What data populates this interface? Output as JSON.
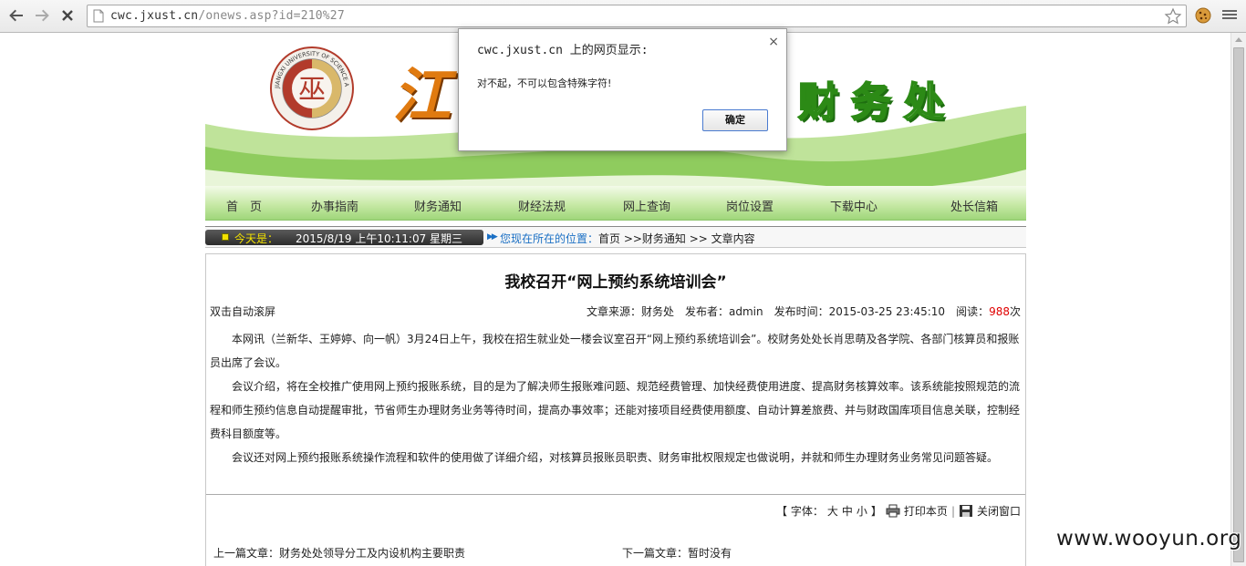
{
  "browser": {
    "url_host": "cwc.jxust.cn",
    "url_rest": "/onews.asp?id=210%27"
  },
  "banner": {
    "title_char": "江",
    "department": "财务处",
    "seal_text": "JIANGXI UNIVERSITY OF SCIENCE AND TECHNOLOGY"
  },
  "nav": {
    "items": [
      "首　页",
      "办事指南",
      "财务通知",
      "财经法规",
      "网上查询",
      "岗位设置",
      "下载中心",
      "处长信箱"
    ]
  },
  "infobar": {
    "today_label": "今天是：",
    "today_value": "2015/8/19 上午10:11:07 星期三",
    "location_label": "您现在所在的位置：",
    "location_path": "首页 >>财务通知 >> 文章内容"
  },
  "article": {
    "title": "我校召开“网上预约系统培训会”",
    "dblclick_scroll": "双击自动滚屏",
    "meta_prefix": "文章来源：财务处　发布者：admin　发布时间：2015-03-25 23:45:10　阅读：",
    "read_count": "988",
    "meta_suffix": "次",
    "paragraphs": [
      "本网讯（兰新华、王婷婷、向一帆）3月24日上午，我校在招生就业处一楼会议室召开“网上预约系统培训会”。校财务处处长肖思萌及各学院、各部门核算员和报账员出席了会议。",
      "会议介绍，将在全校推广使用网上预约报账系统，目的是为了解决师生报账难问题、规范经费管理、加快经费使用进度、提高财务核算效率。该系统能按照规范的流程和师生预约信息自动提醒审批，节省师生办理财务业务等待时间，提高办事效率；还能对接项目经费使用额度、自动计算差旅费、并与财政国库项目信息关联，控制经费科目额度等。",
      "会议还对网上预约报账系统操作流程和软件的使用做了详细介绍，对核算员报账员职责、财务审批权限规定也做说明，并就和师生办理财务业务常见问题答疑。"
    ],
    "font_label": "【 字体：",
    "font_large": "大",
    "font_medium": "中",
    "font_small": "小",
    "font_close": "】",
    "print_label": "打印本页",
    "separator": "|",
    "close_label": "关闭窗口",
    "prev_label": "上一篇文章：财务处处领导分工及内设机构主要职责",
    "next_label": "下一篇文章：暂时没有"
  },
  "dialog": {
    "title": "cwc.jxust.cn 上的网页显示:",
    "close_glyph": "×",
    "message": "对不起，不可以包含特殊字符!",
    "ok_label": "确定"
  },
  "watermark": "www.wooyun.org",
  "colors": {
    "nav_green": "#9fd67a",
    "dept_green": "#2c8a16",
    "title_orange": "#e07a10",
    "read_count_red": "#e00000",
    "location_blue": "#1a6fc4",
    "today_yellow": "#f3e200"
  }
}
